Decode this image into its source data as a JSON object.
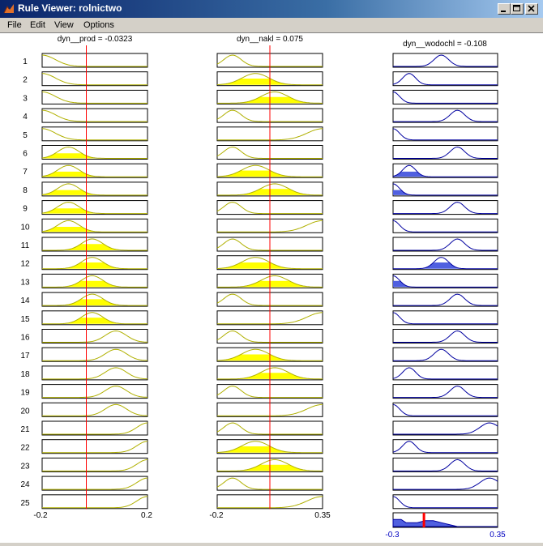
{
  "window": {
    "title": "Rule Viewer: rolnictwo",
    "menu": [
      "File",
      "Edit",
      "View",
      "Options"
    ]
  },
  "colors": {
    "input_fill": "#ffff00",
    "input_line": "#b0b000",
    "output_fill": "#5060e0",
    "output_line": "#0000a0",
    "marker": "#ff0000",
    "output_axis_text": "#0000c0"
  },
  "inputs": [
    {
      "label": "dyn__prod = -0.0323",
      "range": [
        -0.2,
        0.2
      ],
      "range_labels": [
        "-0.2",
        "0.2"
      ],
      "value": -0.0323
    },
    {
      "label": "dyn__nakl = 0.075",
      "range": [
        -0.2,
        0.35
      ],
      "range_labels": [
        "-0.2",
        "0.35"
      ],
      "value": 0.075
    }
  ],
  "output": {
    "label": "dyn__wodochl = -0.108",
    "range": [
      -0.3,
      0.35
    ],
    "range_labels": [
      "-0.3",
      "0.35"
    ],
    "value": -0.108
  },
  "rules": [
    {
      "n": "1",
      "mf": [
        "L",
        "L",
        "M"
      ],
      "w": [
        0,
        0,
        0
      ]
    },
    {
      "n": "2",
      "mf": [
        "L",
        "M",
        "L"
      ],
      "w": [
        0,
        0.55,
        0
      ]
    },
    {
      "n": "3",
      "mf": [
        "L",
        "H",
        "Z"
      ],
      "w": [
        0,
        0.55,
        0
      ]
    },
    {
      "n": "4",
      "mf": [
        "L",
        "L",
        "H"
      ],
      "w": [
        0,
        0,
        0
      ]
    },
    {
      "n": "5",
      "mf": [
        "L",
        "V",
        "Z"
      ],
      "w": [
        0,
        0,
        0
      ]
    },
    {
      "n": "6",
      "mf": [
        "M",
        "L",
        "H"
      ],
      "w": [
        0.45,
        0,
        0
      ]
    },
    {
      "n": "7",
      "mf": [
        "M",
        "M",
        "L"
      ],
      "w": [
        0.45,
        0.55,
        0.45
      ]
    },
    {
      "n": "8",
      "mf": [
        "M",
        "H",
        "Z"
      ],
      "w": [
        0.45,
        0.55,
        0.45
      ]
    },
    {
      "n": "9",
      "mf": [
        "M",
        "L",
        "H"
      ],
      "w": [
        0.45,
        0,
        0
      ]
    },
    {
      "n": "10",
      "mf": [
        "M",
        "V",
        "Z"
      ],
      "w": [
        0.45,
        0,
        0
      ]
    },
    {
      "n": "11",
      "mf": [
        "N",
        "L",
        "H"
      ],
      "w": [
        0.55,
        0,
        0
      ]
    },
    {
      "n": "12",
      "mf": [
        "N",
        "M",
        "M"
      ],
      "w": [
        0.55,
        0.55,
        0.55
      ]
    },
    {
      "n": "13",
      "mf": [
        "N",
        "H",
        "Z"
      ],
      "w": [
        0.55,
        0.55,
        0.55
      ]
    },
    {
      "n": "14",
      "mf": [
        "N",
        "L",
        "H"
      ],
      "w": [
        0.55,
        0,
        0
      ]
    },
    {
      "n": "15",
      "mf": [
        "N",
        "V",
        "Z"
      ],
      "w": [
        0.55,
        0,
        0
      ]
    },
    {
      "n": "16",
      "mf": [
        "O",
        "L",
        "H"
      ],
      "w": [
        0,
        0,
        0
      ]
    },
    {
      "n": "17",
      "mf": [
        "O",
        "M",
        "M"
      ],
      "w": [
        0,
        0.55,
        0
      ]
    },
    {
      "n": "18",
      "mf": [
        "O",
        "H",
        "L"
      ],
      "w": [
        0,
        0.55,
        0
      ]
    },
    {
      "n": "19",
      "mf": [
        "O",
        "L",
        "H"
      ],
      "w": [
        0,
        0,
        0
      ]
    },
    {
      "n": "20",
      "mf": [
        "O",
        "V",
        "Z"
      ],
      "w": [
        0,
        0,
        0
      ]
    },
    {
      "n": "21",
      "mf": [
        "R",
        "L",
        "V"
      ],
      "w": [
        0,
        0,
        0
      ]
    },
    {
      "n": "22",
      "mf": [
        "R",
        "M",
        "L"
      ],
      "w": [
        0,
        0.55,
        0
      ]
    },
    {
      "n": "23",
      "mf": [
        "R",
        "H",
        "H"
      ],
      "w": [
        0,
        0.55,
        0
      ]
    },
    {
      "n": "24",
      "mf": [
        "R",
        "L",
        "V"
      ],
      "w": [
        0,
        0,
        0
      ]
    },
    {
      "n": "25",
      "mf": [
        "R",
        "V",
        "Z"
      ],
      "w": [
        0,
        0,
        0
      ]
    }
  ],
  "mf_shapes": {
    "in": {
      "L": {
        "c": -0.2,
        "s": 0.05
      },
      "M": {
        "c": -0.1,
        "s": 0.04
      },
      "N": {
        "c": -0.01,
        "s": 0.04
      },
      "O": {
        "c": 0.08,
        "s": 0.04
      },
      "R": {
        "c": 0.2,
        "s": 0.04
      },
      "H": {
        "c": 0.1,
        "s": 0.07
      }
    },
    "in2": {
      "L": {
        "c": -0.12,
        "s": 0.045
      },
      "M": {
        "c": 0.0,
        "s": 0.07
      },
      "H": {
        "c": 0.1,
        "s": 0.07
      },
      "V": {
        "c": 0.35,
        "s": 0.08
      }
    },
    "out": {
      "Z": {
        "c": -0.3,
        "s": 0.04
      },
      "L": {
        "c": -0.2,
        "s": 0.04
      },
      "M": {
        "c": 0.0,
        "s": 0.045
      },
      "H": {
        "c": 0.1,
        "s": 0.045
      },
      "V": {
        "c": 0.3,
        "s": 0.06
      }
    }
  },
  "aggregate": {
    "points": [
      [
        -0.3,
        0.55
      ],
      [
        -0.25,
        0.55
      ],
      [
        -0.22,
        0.3
      ],
      [
        -0.2,
        0.3
      ],
      [
        -0.15,
        0.3
      ],
      [
        -0.1,
        0.45
      ],
      [
        -0.05,
        0.45
      ],
      [
        0.0,
        0.3
      ],
      [
        0.05,
        0.15
      ],
      [
        0.1,
        0.0
      ],
      [
        0.35,
        0.0
      ]
    ]
  }
}
